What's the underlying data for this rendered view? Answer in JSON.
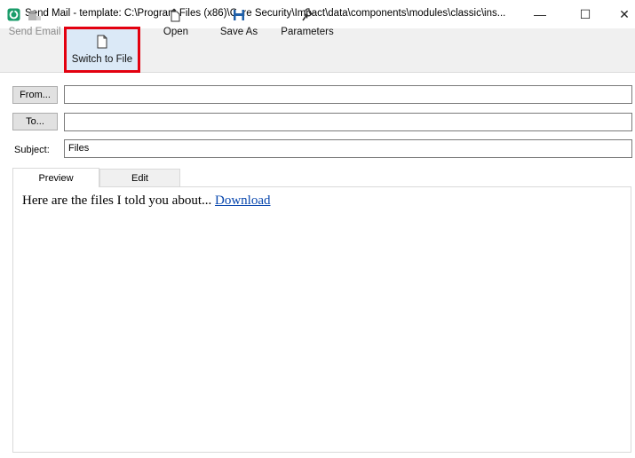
{
  "window": {
    "title": "Send Mail - template: C:\\Program Files (x86)\\Core Security\\Impact\\data\\components\\modules\\classic\\ins...",
    "minimize_glyph": "—",
    "maximize_glyph": "☐",
    "close_glyph": "✕",
    "app_icon": "core-impact-logo-icon",
    "app_icon_color": "#1a9c6a"
  },
  "toolbar": {
    "send_email_label": "Send Email",
    "switch_to_file_label": "Switch to File",
    "open_label": "Open",
    "save_as_label": "Save As",
    "parameters_label": "Parameters",
    "highlight_color": "#e3000f"
  },
  "form": {
    "from_button_label": "From...",
    "from_value": "",
    "to_button_label": "To...",
    "to_value": "",
    "subject_label": "Subject:",
    "subject_value": "Files"
  },
  "tabs": {
    "preview_label": "Preview",
    "edit_label": "Edit",
    "active": "Preview"
  },
  "preview": {
    "body_text": "Here are the files I told you about... ",
    "link_text": "Download",
    "link_color": "#0645ad"
  }
}
